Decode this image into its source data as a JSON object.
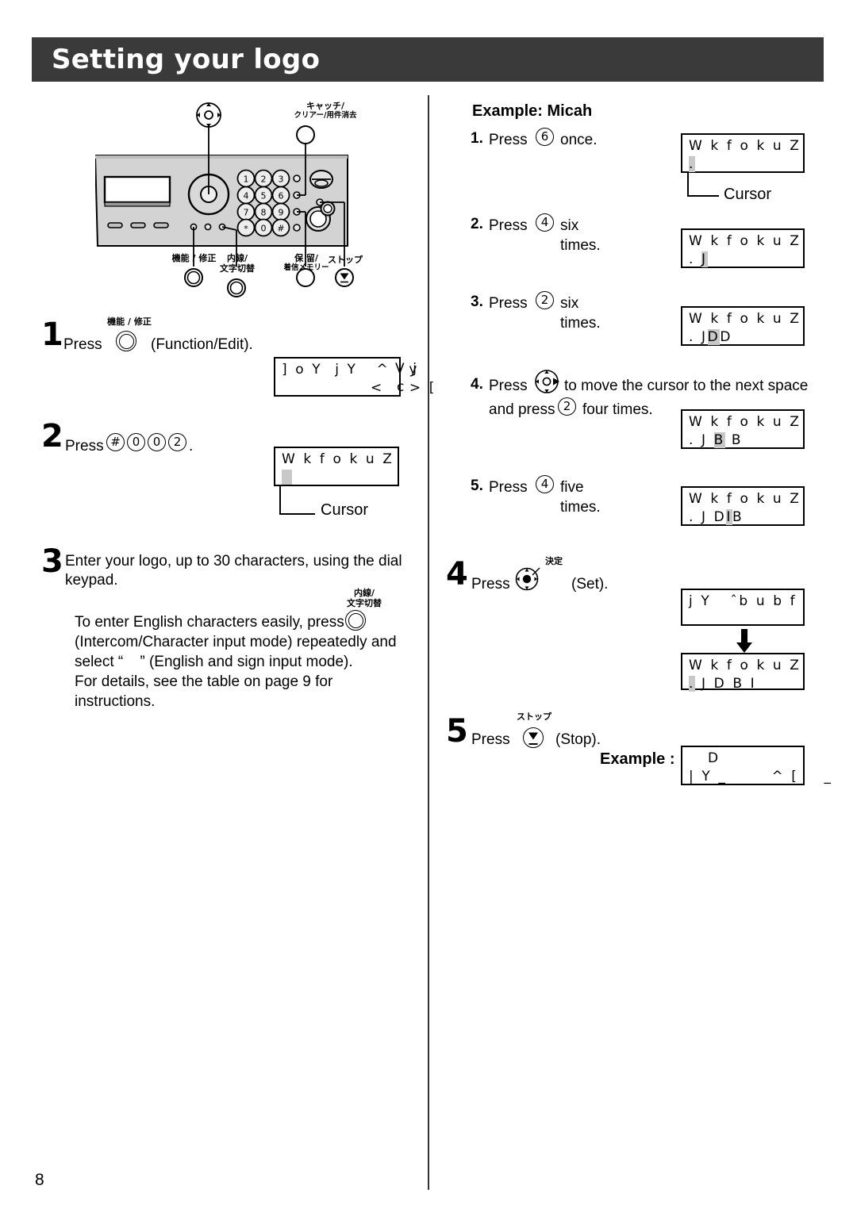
{
  "page": {
    "title": "Setting your logo",
    "page_number": "8"
  },
  "device": {
    "labels": {
      "catch_clear": "キャッチ/",
      "catch_clear_sub": "クリアー/用件消去",
      "function_edit": "機能 / 修正",
      "intercom": "内線/",
      "intercom_sub": "文字切替",
      "hold": "保 留/",
      "hold_sub": "着信メモリー",
      "stop": "ストップ"
    },
    "keypad": [
      "1",
      "2",
      "3",
      "4",
      "5",
      "6",
      "7",
      "8",
      "9",
      "*",
      "0",
      "#"
    ]
  },
  "left_column": {
    "step1": {
      "num": "1",
      "press": "Press",
      "jp_label": "機能 / 修正",
      "after": "(Function/Edit).",
      "lcd": {
        "line1": "] o Y  j Y   ^   y",
        "line1_overflow": "V j",
        "line2": "              <    > [",
        "line2_overflow": "c"
      }
    },
    "step2": {
      "num": "2",
      "press": "Press",
      "keys": [
        "#",
        "0",
        "0",
        "2"
      ],
      "period": ".",
      "lcd": {
        "line1": "W k f o k u Z",
        "line2_cursor": true
      },
      "cursor_label": "Cursor"
    },
    "step3": {
      "num": "3",
      "line1": "Enter your logo, up to 30 characters, using the dial",
      "line2": "keypad.",
      "jp_label_top": "内線/",
      "jp_label_bottom": "文字切替",
      "body1": "To enter English characters easily, press",
      "body2": "(Intercom/Character input mode) repeatedly and",
      "body3_pre": "select “",
      "body3_post": "” (English and sign input mode).",
      "body4": "For details, see the table on page 9 for instructions."
    }
  },
  "right_column": {
    "example_heading": "Example: Micah",
    "substeps": [
      {
        "num": "1.",
        "press": "Press",
        "key": "6",
        "after": "once.",
        "lcd_line1": "W k f o k u Z",
        "lcd_line2_pre": "",
        "lcd_line2_hl": ".",
        "lcd_line2_post": "",
        "cursor_label": "Cursor"
      },
      {
        "num": "2.",
        "press": "Press",
        "key": "4",
        "after": "six times.",
        "lcd_line1": "W k f o k u Z",
        "lcd_line2_pre": ". ",
        "lcd_line2_hl": "J",
        "lcd_line2_post": ""
      },
      {
        "num": "3.",
        "press": "Press",
        "key": "2",
        "after": "six times.",
        "lcd_line1": "W k f o k u Z",
        "lcd_line2_pre": ". J",
        "lcd_line2_hl": "D",
        "lcd_line2_post": "D"
      },
      {
        "num": "4.",
        "press": "Press",
        "after": "to move the cursor to the next space",
        "line2_pre": "and press",
        "key": "2",
        "line2_post": "four times.",
        "lcd_line1": "W k f o k u Z",
        "lcd_line2_pre": ". J ",
        "lcd_line2_hl": "B",
        "lcd_line2_post": " B"
      },
      {
        "num": "5.",
        "press": "Press",
        "key": "4",
        "after": "five times.",
        "lcd_line1": "W k f o k u Z",
        "lcd_line2_pre": ". J D",
        "lcd_line2_hl": "I",
        "lcd_line2_post": "B"
      }
    ],
    "step4": {
      "num": "4",
      "press": "Press",
      "jp_label": "決定",
      "after": "(Set).",
      "lcd_before_line1": "j Y   ˆb u b f",
      "lcd_after_line1": "W k f o k u Z",
      "lcd_after_line2_hl": ".",
      "lcd_after_line2_post": " J D B I"
    },
    "step5": {
      "num": "5",
      "press": "Press",
      "jp_label": "ストップ",
      "after": "(Stop).",
      "example_label": "Example :",
      "lcd_line1": "   D",
      "lcd_line2": "| Y _       ^ [    _"
    }
  }
}
